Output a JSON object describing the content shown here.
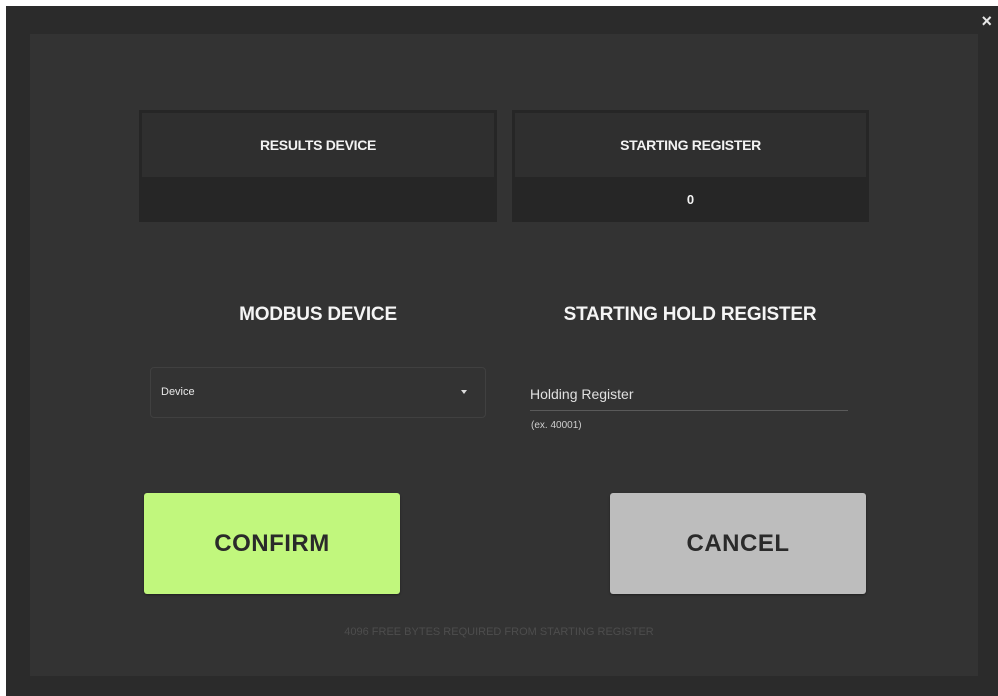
{
  "dialog": {
    "close_label": "×"
  },
  "info_cards": {
    "results_device": {
      "title": "RESULTS DEVICE",
      "value": ""
    },
    "starting_register": {
      "title": "STARTING REGISTER",
      "value": "0"
    }
  },
  "modbus_device": {
    "title": "MODBUS DEVICE",
    "select_value": "Device",
    "caret_icon": "triangle-down-icon"
  },
  "hold_register": {
    "title": "STARTING HOLD REGISTER",
    "placeholder": "Holding Register",
    "hint": "(ex. 40001)"
  },
  "buttons": {
    "confirm": "CONFIRM",
    "cancel": "CANCEL"
  },
  "footer": {
    "note": "4096 FREE BYTES REQUIRED FROM STARTING REGISTER"
  },
  "colors": {
    "confirm": "#c1f77d",
    "cancel": "#bdbdbd",
    "background": "#2b2b2b"
  }
}
